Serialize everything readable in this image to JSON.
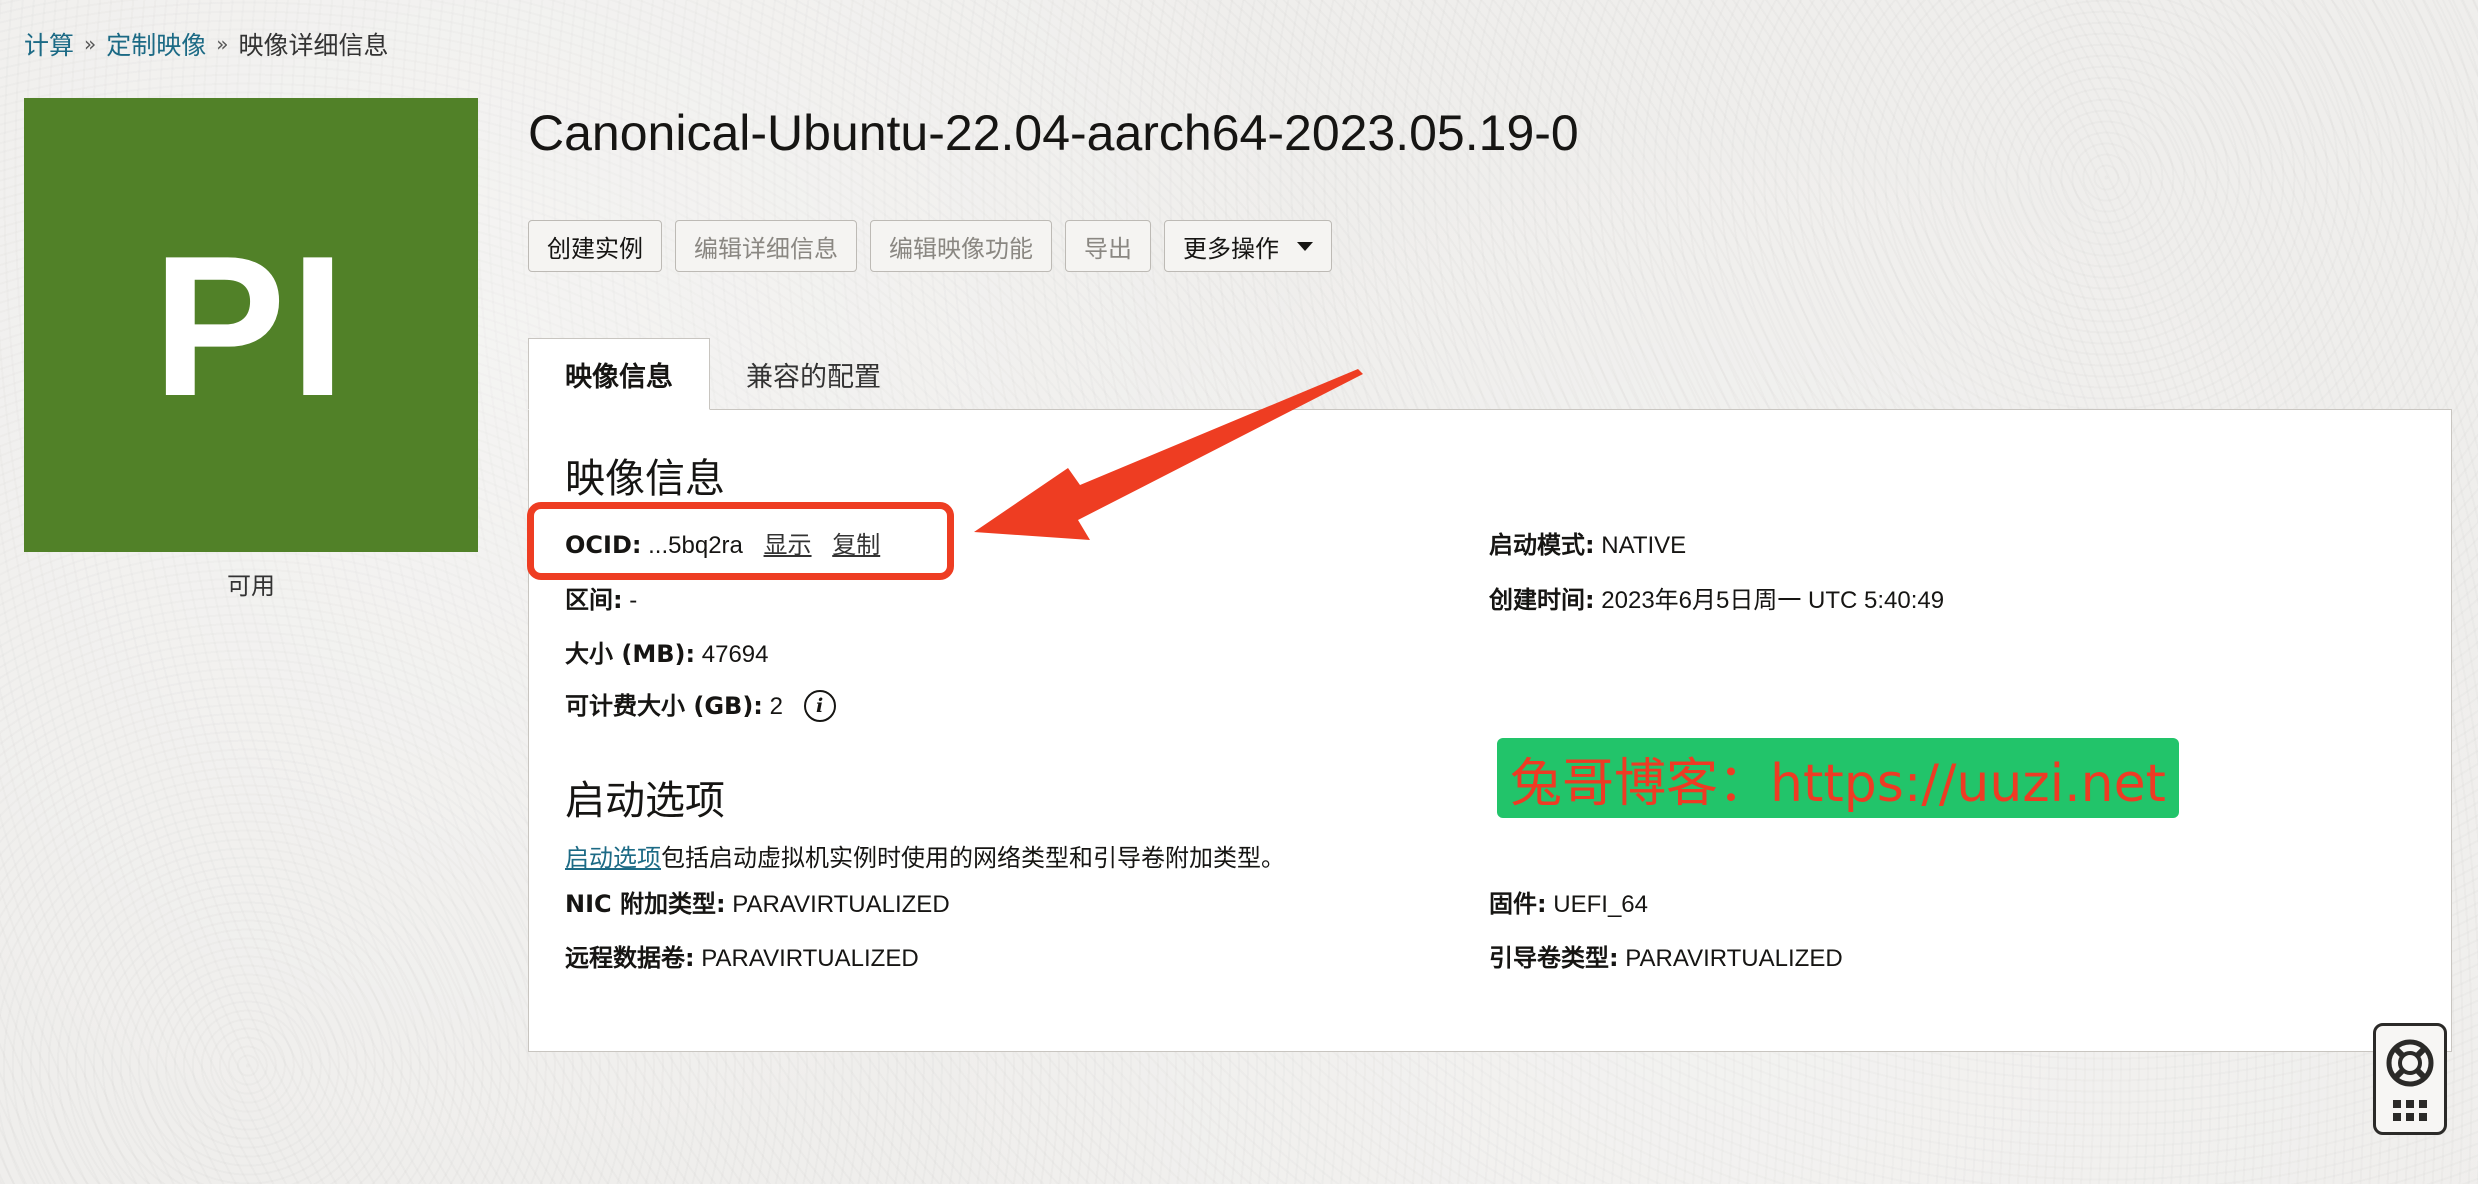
{
  "breadcrumb": {
    "items": [
      {
        "label": "计算"
      },
      {
        "label": "定制映像"
      }
    ],
    "separator": "»",
    "current": "映像详细信息"
  },
  "tile": {
    "initials": "PI",
    "status": "可用",
    "color": "#518128"
  },
  "title": "Canonical-Ubuntu-22.04-aarch64-2023.05.19-0",
  "actions": {
    "create_instance": "创建实例",
    "edit_details": "编辑详细信息",
    "edit_capabilities": "编辑映像功能",
    "export": "导出",
    "more_actions": "更多操作"
  },
  "tabs": {
    "image_info": "映像信息",
    "compatible_shapes": "兼容的配置"
  },
  "image_info": {
    "heading": "映像信息",
    "ocid": {
      "label": "OCID:",
      "value": "...5bq2ra",
      "show": "显示",
      "copy": "复制"
    },
    "launch_mode": {
      "label": "启动模式:",
      "value": "NATIVE"
    },
    "zone": {
      "label": "区间:",
      "value": "-"
    },
    "created": {
      "label": "创建时间:",
      "value": "2023年6月5日周一 UTC 5:40:49"
    },
    "size": {
      "label": "大小 (MB):",
      "value": "47694"
    },
    "billable_size": {
      "label": "可计费大小 (GB):",
      "value": "2"
    }
  },
  "launch_options": {
    "heading": "启动选项",
    "desc_link": "启动选项",
    "desc_text": "包括启动虚拟机实例时使用的网络类型和引导卷附加类型。",
    "nic": {
      "label": "NIC 附加类型:",
      "value": "PARAVIRTUALIZED"
    },
    "firmware": {
      "label": "固件:",
      "value": "UEFI_64"
    },
    "remote_volume": {
      "label": "远程数据卷:",
      "value": "PARAVIRTUALIZED"
    },
    "boot_volume": {
      "label": "引导卷类型:",
      "value": "PARAVIRTUALIZED"
    }
  },
  "watermark": "兔哥博客：https://uuzi.net",
  "colors": {
    "link": "#1c6a85",
    "annotation_red": "#ee3d22",
    "watermark_bg": "#22c46a"
  }
}
